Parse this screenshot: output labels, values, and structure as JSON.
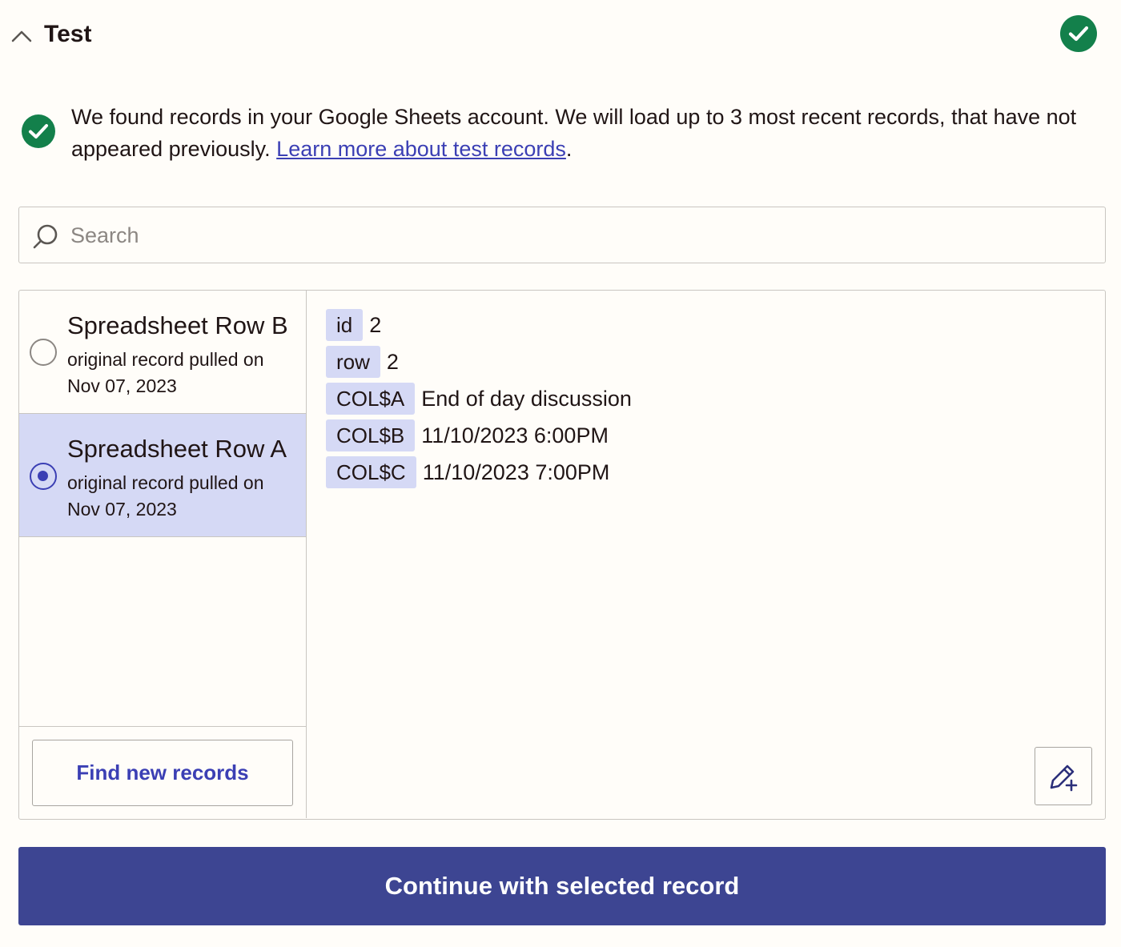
{
  "header": {
    "title": "Test"
  },
  "info": {
    "message": "We found records in your Google Sheets account. We will load up to 3 most recent records, that have not appeared previously. ",
    "link_text": "Learn more about test records",
    "trailing": "."
  },
  "search": {
    "placeholder": "Search",
    "value": ""
  },
  "records": [
    {
      "title": "Spreadsheet Row B",
      "subtitle": "original record pulled on Nov 07, 2023",
      "selected": false
    },
    {
      "title": "Spreadsheet Row A",
      "subtitle": "original record pulled on Nov 07, 2023",
      "selected": true
    }
  ],
  "fields": [
    {
      "key": "id",
      "value": "2"
    },
    {
      "key": "row",
      "value": "2"
    },
    {
      "key": "COL$A",
      "value": "End of day discussion"
    },
    {
      "key": "COL$B",
      "value": "11/10/2023 6:00PM"
    },
    {
      "key": "COL$C",
      "value": "11/10/2023 7:00PM"
    }
  ],
  "buttons": {
    "find_new_records": "Find new records",
    "continue": "Continue with selected record"
  },
  "colors": {
    "accent": "#3b3fb4",
    "primary_button": "#3d4592",
    "selected_bg": "#d5d9f5",
    "success": "#13804b"
  },
  "icons": {
    "collapse": "chevron-up-icon",
    "status": "check-circle-icon",
    "search": "search-icon",
    "edit": "pencil-plus-icon"
  }
}
